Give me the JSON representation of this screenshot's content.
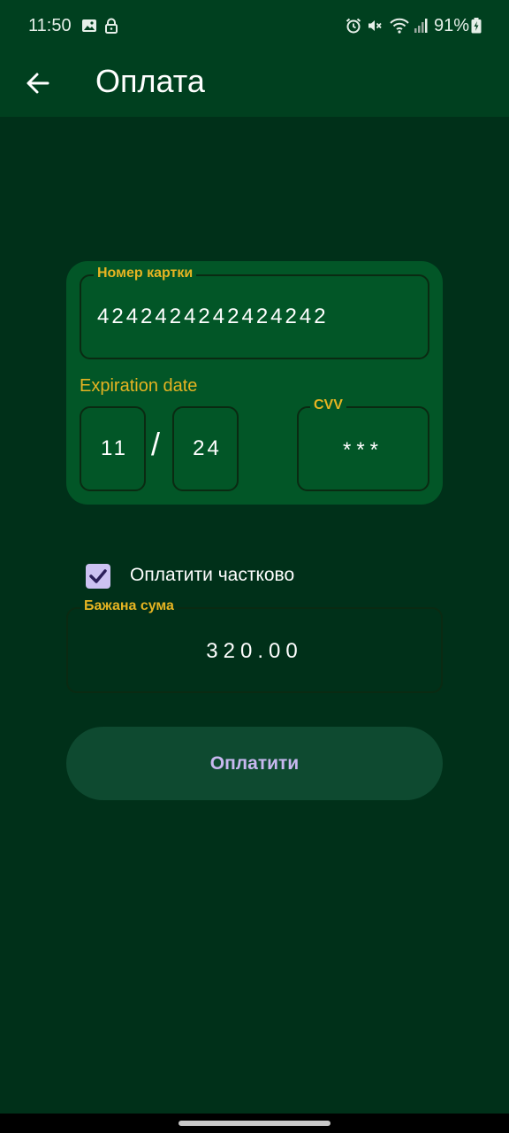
{
  "status_bar": {
    "time": "11:50",
    "battery": "91%",
    "icons": [
      "image-icon",
      "lock-icon",
      "alarm-icon",
      "mute-icon",
      "wifi-icon",
      "signal-icon",
      "battery-icon"
    ]
  },
  "app_bar": {
    "title": "Оплата",
    "back_icon": "arrow-left-icon"
  },
  "card_form": {
    "card_number": {
      "label": "Номер картки",
      "value": "4242424242424242"
    },
    "expiration": {
      "label": "Expiration date",
      "month": "11",
      "separator": "/",
      "year": "24"
    },
    "cvv": {
      "label": "CVV",
      "value": "***"
    }
  },
  "partial_payment": {
    "checked": true,
    "label": "Оплатити частково"
  },
  "amount": {
    "label": "Бажана сума",
    "value": "320.00"
  },
  "pay_button": {
    "label": "Оплатити"
  },
  "colors": {
    "background": "#003019",
    "app_bar": "#00401f",
    "card": "#025627",
    "accent_label": "#e6b422",
    "button_bg": "#0e4a30",
    "button_text": "#c8b8f0",
    "checkbox": "#ccc2f2"
  }
}
